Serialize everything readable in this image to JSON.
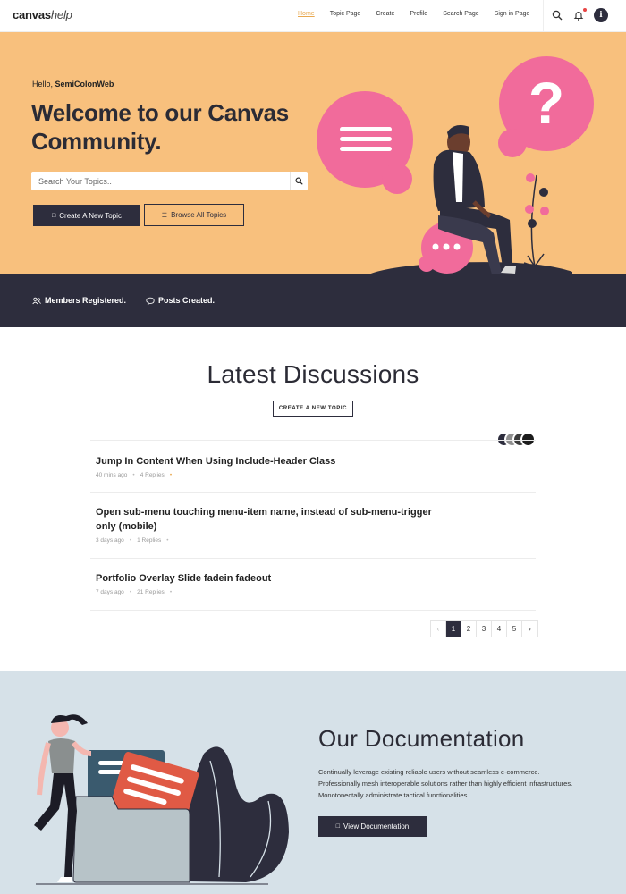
{
  "header": {
    "logo_bold": "canvas",
    "logo_italic": "help",
    "nav": [
      {
        "label": "Home",
        "active": true
      },
      {
        "label": "Topic Page"
      },
      {
        "label": "Create"
      },
      {
        "label": "Profile"
      },
      {
        "label": "Search Page"
      },
      {
        "label": "Sign in Page"
      }
    ],
    "icons": [
      "search-icon",
      "bell-icon",
      "info-icon"
    ],
    "accent_color": "#e8a84f"
  },
  "hero": {
    "greeting": "Hello,",
    "username": "SemiColonWeb",
    "title": "Welcome to our Canvas Community.",
    "search_placeholder": "Search Your Topics..",
    "create_button": "Create A New Topic",
    "browse_button": "Browse All Topics",
    "background_color": "#f8c07d"
  },
  "stats": {
    "members_label": "Members Registered.",
    "posts_label": "Posts Created."
  },
  "discussions": {
    "title": "Latest Discussions",
    "create_button": "CREATE A NEW TOPIC",
    "topics": [
      {
        "title": "Jump In Content When Using Include-Header Class",
        "time": "40 mins ago",
        "replies": "4 Replies"
      },
      {
        "title": "Open sub-menu touching menu-item name, instead of sub-menu-trigger only (mobile)",
        "time": "3 days ago",
        "replies": "1 Replies"
      },
      {
        "title": "Portfolio Overlay Slide fadein fadeout",
        "time": "7 days ago",
        "replies": "21 Replies"
      }
    ],
    "pagination": [
      "‹",
      "1",
      "2",
      "3",
      "4",
      "5",
      "›"
    ],
    "current_page": "1"
  },
  "docs": {
    "title": "Our Documentation",
    "text": "Continually leverage existing reliable users without seamless e-commerce. Professionally mesh interoperable solutions rather than highly efficient infrastructures. Monotonectally administrate tactical functionalities.",
    "button": "View Documentation",
    "background_color": "#d6e1e8"
  }
}
